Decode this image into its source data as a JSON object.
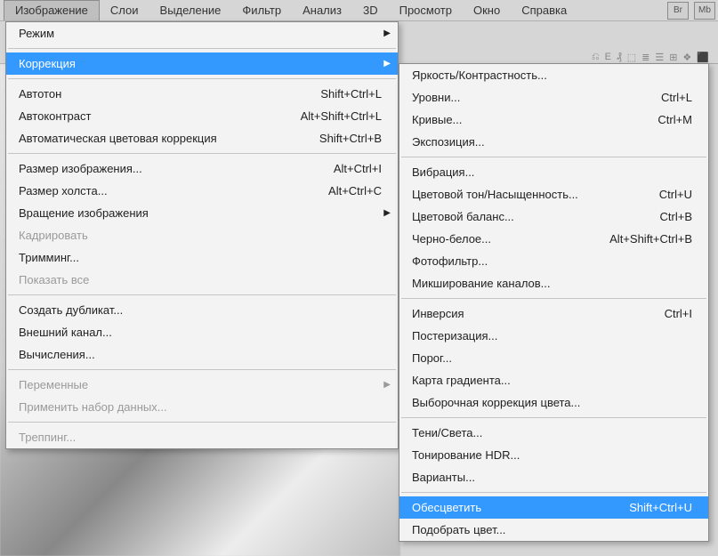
{
  "menubar": {
    "items": [
      "Изображение",
      "Слои",
      "Выделение",
      "Фильтр",
      "Анализ",
      "3D",
      "Просмотр",
      "Окно",
      "Справка"
    ],
    "activeIndex": 0,
    "btns": [
      "Br",
      "Mb"
    ]
  },
  "menu": [
    {
      "label": "Режим",
      "arrow": true
    },
    "---",
    {
      "label": "Коррекция",
      "arrow": true,
      "hover": true
    },
    "---",
    {
      "label": "Автотон",
      "shortcut": "Shift+Ctrl+L"
    },
    {
      "label": "Автоконтраст",
      "shortcut": "Alt+Shift+Ctrl+L"
    },
    {
      "label": "Автоматическая цветовая коррекция",
      "shortcut": "Shift+Ctrl+B"
    },
    "---",
    {
      "label": "Размер изображения...",
      "shortcut": "Alt+Ctrl+I"
    },
    {
      "label": "Размер холста...",
      "shortcut": "Alt+Ctrl+C"
    },
    {
      "label": "Вращение изображения",
      "arrow": true
    },
    {
      "label": "Кадрировать",
      "disabled": true
    },
    {
      "label": "Тримминг..."
    },
    {
      "label": "Показать все",
      "disabled": true
    },
    "---",
    {
      "label": "Создать дубликат..."
    },
    {
      "label": "Внешний канал..."
    },
    {
      "label": "Вычисления..."
    },
    "---",
    {
      "label": "Переменные",
      "arrow": true,
      "disabled": true
    },
    {
      "label": "Применить набор данных...",
      "disabled": true
    },
    "---",
    {
      "label": "Треппинг...",
      "disabled": true
    }
  ],
  "submenu": [
    {
      "label": "Яркость/Контрастность..."
    },
    {
      "label": "Уровни...",
      "shortcut": "Ctrl+L"
    },
    {
      "label": "Кривые...",
      "shortcut": "Ctrl+M"
    },
    {
      "label": "Экспозиция..."
    },
    "---",
    {
      "label": "Вибрация..."
    },
    {
      "label": "Цветовой тон/Насыщенность...",
      "shortcut": "Ctrl+U"
    },
    {
      "label": "Цветовой баланс...",
      "shortcut": "Ctrl+B"
    },
    {
      "label": "Черно-белое...",
      "shortcut": "Alt+Shift+Ctrl+B"
    },
    {
      "label": "Фотофильтр..."
    },
    {
      "label": "Микширование каналов..."
    },
    "---",
    {
      "label": "Инверсия",
      "shortcut": "Ctrl+I"
    },
    {
      "label": "Постеризация..."
    },
    {
      "label": "Порог..."
    },
    {
      "label": "Карта градиента..."
    },
    {
      "label": "Выборочная коррекция цвета..."
    },
    "---",
    {
      "label": "Тени/Света..."
    },
    {
      "label": "Тонирование HDR..."
    },
    {
      "label": "Варианты..."
    },
    "---",
    {
      "label": "Обесцветить",
      "shortcut": "Shift+Ctrl+U",
      "hover": true
    },
    {
      "label": "Подобрать цвет..."
    }
  ],
  "toolicons": [
    "⎌",
    "E",
    "₰",
    "⬚",
    "≣",
    "☰",
    "⊞",
    "❖",
    "⬛"
  ]
}
